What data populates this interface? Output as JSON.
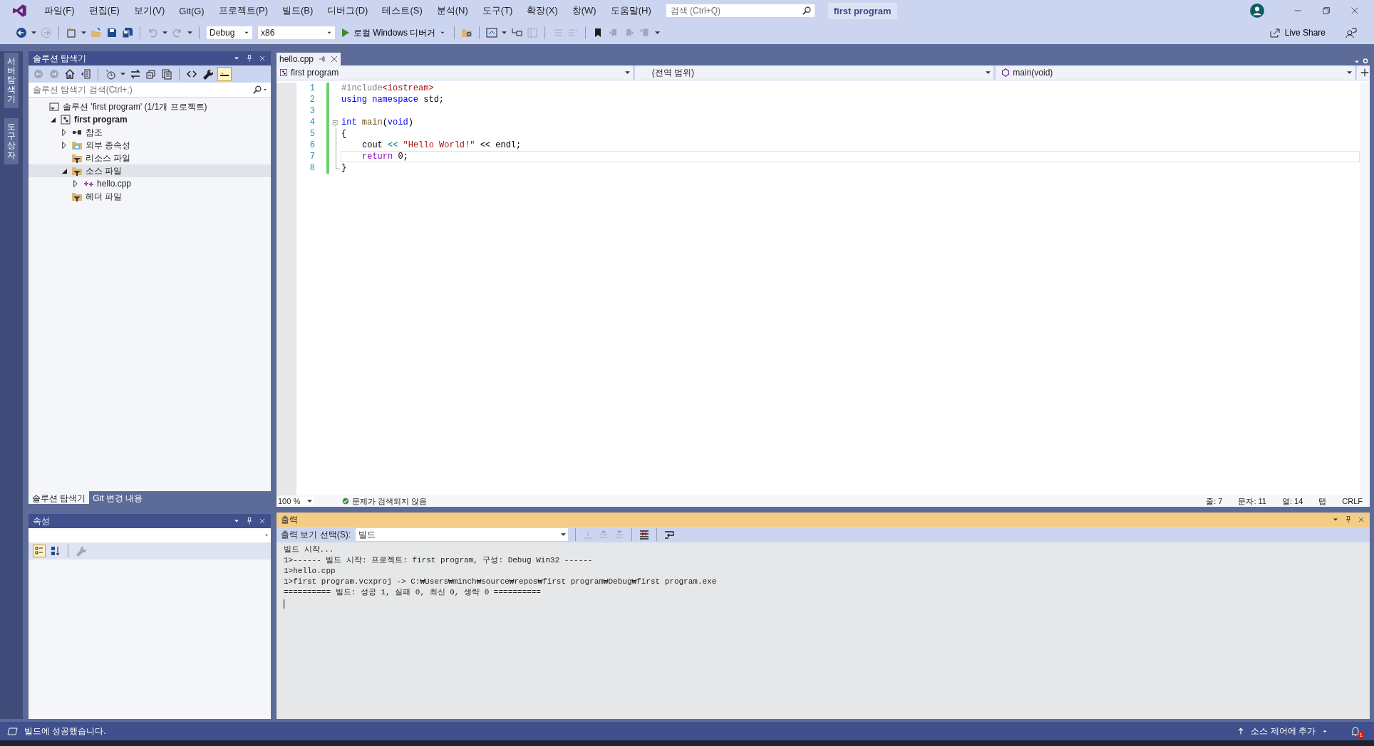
{
  "menu": [
    "파일(F)",
    "편집(E)",
    "보기(V)",
    "Git(G)",
    "프로젝트(P)",
    "빌드(B)",
    "디버그(D)",
    "테스트(S)",
    "분석(N)",
    "도구(T)",
    "확장(X)",
    "창(W)",
    "도움말(H)"
  ],
  "search": {
    "placeholder": "검색 (Ctrl+Q)"
  },
  "solution_name": "first program",
  "toolbar": {
    "configuration": "Debug",
    "platform": "x86",
    "run": "로컬 Windows 디버거",
    "live_share": "Live Share"
  },
  "side_tabs": [
    "서버 탐색기",
    "도구 상자"
  ],
  "solution_explorer": {
    "title": "솔루션 탐색기",
    "search": {
      "placeholder": "솔루션 탐색기 검색(Ctrl+;)"
    },
    "tree": [
      {
        "label": "솔루션 'first program' (1/1개 프로젝트)",
        "kind": "solution",
        "selected": false,
        "children": [
          {
            "label": "first program",
            "kind": "project",
            "expanded": true,
            "selected": false,
            "children": [
              {
                "label": "참조",
                "kind": "references",
                "expanded": false,
                "selected": false
              },
              {
                "label": "외부 종속성",
                "kind": "external",
                "expanded": false,
                "selected": false
              },
              {
                "label": "리소스 파일",
                "kind": "filter",
                "selected": false
              },
              {
                "label": "소스 파일",
                "kind": "filter",
                "expanded": true,
                "selected": true,
                "children": [
                  {
                    "label": "hello.cpp",
                    "kind": "cpp",
                    "expanded": false,
                    "selected": false
                  }
                ]
              },
              {
                "label": "헤더 파일",
                "kind": "filter",
                "selected": false
              }
            ]
          }
        ]
      }
    ],
    "tabs": [
      {
        "label": "솔루션 탐색기",
        "selected": true
      },
      {
        "label": "Git 변경 내용",
        "selected": false
      }
    ]
  },
  "properties": {
    "title": "속성"
  },
  "editor": {
    "tabs": [
      {
        "label": "hello.cpp",
        "selected": true
      }
    ],
    "nav": [
      "first program",
      "(전역 범위)",
      "main(void)"
    ],
    "lines": [
      {
        "number": "1",
        "kind": "plain",
        "indent": false,
        "current": false,
        "tokens": [
          {
            "text": "#include",
            "kind": "preproc"
          },
          {
            "text": "<iostream>",
            "kind": "string"
          }
        ]
      },
      {
        "number": "2",
        "kind": "plain",
        "indent": false,
        "current": false,
        "tokens": [
          {
            "text": "using namespace",
            "kind": "keyword"
          },
          {
            "text": " std;",
            "kind": "plain"
          }
        ]
      },
      {
        "number": "3",
        "kind": "plain",
        "current": false
      },
      {
        "number": "4",
        "kind": "fold_start",
        "indent": false,
        "current": false,
        "tokens": [
          {
            "text": "int",
            "kind": "keyword"
          },
          {
            "text": " main",
            "kind": "function"
          },
          {
            "text": "(",
            "kind": "plain"
          },
          {
            "text": "void",
            "kind": "keyword"
          },
          {
            "text": ")",
            "kind": "plain"
          }
        ]
      },
      {
        "number": "5",
        "kind": "fold_inner",
        "indent": false,
        "current": false,
        "tokens": [
          {
            "text": "{",
            "kind": "plain"
          }
        ]
      },
      {
        "number": "6",
        "kind": "fold_inner",
        "indent": true,
        "current": false,
        "tokens": [
          {
            "text": "cout ",
            "kind": "plain"
          },
          {
            "text": "<<",
            "kind": "operator"
          },
          {
            "text": " \"Hello World!\"",
            "kind": "string"
          },
          {
            "text": " << endl;",
            "kind": "plain"
          }
        ]
      },
      {
        "number": "7",
        "kind": "fold_inner",
        "indent": true,
        "current": true,
        "tokens": [
          {
            "text": "return",
            "kind": "control"
          },
          {
            "text": " 0;",
            "kind": "plain"
          }
        ]
      },
      {
        "number": "8",
        "kind": "fold_end",
        "indent": false,
        "current": false,
        "tokens": [
          {
            "text": "}",
            "kind": "plain"
          }
        ]
      }
    ],
    "status": {
      "zoom": "100 %",
      "issues": "문제가 검색되지 않음",
      "position": [
        "줄: 7",
        "문자: 11",
        "열: 14",
        "탭",
        "CRLF"
      ]
    }
  },
  "output": {
    "title": "출력",
    "source_label": "출력 보기 선택(S):",
    "source": "빌드",
    "lines": [
      "빌드 시작...",
      "1>------ 빌드 시작: 프로젝트: first program, 구성: Debug Win32 ------",
      "1>hello.cpp",
      "1>first program.vcxproj -> C:₩Users₩minch₩source₩repos₩first program₩Debug₩first program.exe",
      "========== 빌드: 성공 1, 실패 0, 최신 0, 생략 0 =========="
    ]
  },
  "status_bar": {
    "message": "빌드에 성공했습니다.",
    "source_control": "소스 제어에 추가",
    "notifications": "1"
  }
}
